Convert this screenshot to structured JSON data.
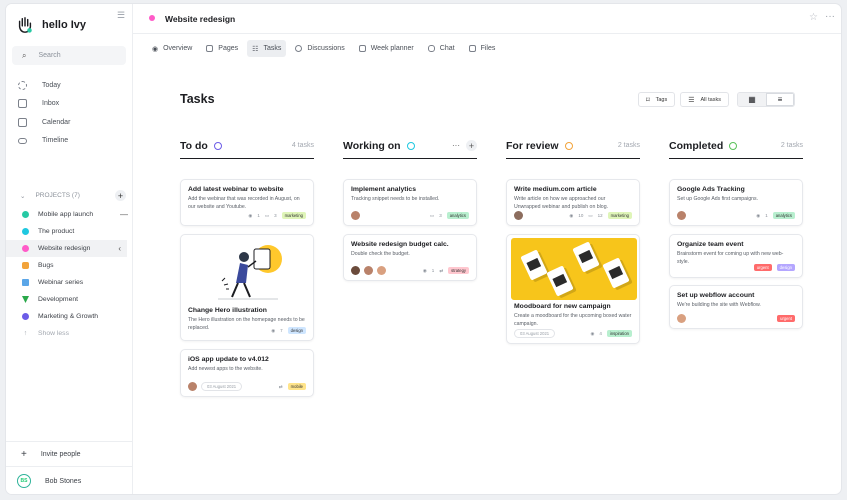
{
  "app": {
    "name": "hello Ivy"
  },
  "sidebar": {
    "search_placeholder": "Search",
    "nav": [
      {
        "label": "Today",
        "icon": "dashed-circle-icon"
      },
      {
        "label": "Inbox",
        "icon": "inbox-icon"
      },
      {
        "label": "Calendar",
        "icon": "calendar-icon"
      },
      {
        "label": "Timeline",
        "icon": "timeline-icon"
      }
    ],
    "projects_label": "PROJECTS (7)",
    "projects": [
      {
        "label": "Mobile app launch",
        "color": "#27c9a4"
      },
      {
        "label": "The product",
        "color": "#1fc8e0"
      },
      {
        "label": "Website redesign",
        "color": "#ff5bc8"
      },
      {
        "label": "Bugs",
        "color": "#f2a33a"
      },
      {
        "label": "Webinar series",
        "color": "#5aa6e8"
      },
      {
        "label": "Development",
        "color": "#2aa84a"
      },
      {
        "label": "Marketing & Growth",
        "color": "#6c5ce7"
      }
    ],
    "show_less": "Show less",
    "invite": "Invite people",
    "user": {
      "initials": "BS",
      "name": "Bob Stones"
    }
  },
  "header": {
    "project": "Website redesign"
  },
  "tabs": [
    {
      "label": "Overview"
    },
    {
      "label": "Pages"
    },
    {
      "label": "Tasks"
    },
    {
      "label": "Discussions"
    },
    {
      "label": "Week planner"
    },
    {
      "label": "Chat"
    },
    {
      "label": "Files"
    }
  ],
  "page": {
    "title": "Tasks",
    "tags_btn": "Tags",
    "all_tasks_btn": "All tasks"
  },
  "columns": [
    {
      "title": "To do",
      "count": "4 tasks",
      "ring": "#6c5ce7"
    },
    {
      "title": "Working on",
      "count": "",
      "ring": "#1fc8e0"
    },
    {
      "title": "For review",
      "count": "2 tasks",
      "ring": "#f2a33a"
    },
    {
      "title": "Completed",
      "count": "2 tasks",
      "ring": "#5ac25a"
    }
  ],
  "cards": {
    "c1": {
      "title": "Add latest webinar to website",
      "desc": "Add the webinar that was recorded in August, on our website and Youtube.",
      "tag": "marketing",
      "tag_color": "#dff5b8",
      "views": "1",
      "comments": "3"
    },
    "c2": {
      "title": "Change Hero illustration",
      "desc": "The Hero illustration on the homepage needs to be replaced.",
      "tag": "design",
      "tag_color": "#cfe6ff",
      "views": "7"
    },
    "c3": {
      "title": "iOS app update to v4.012",
      "desc": "Add newest apps to the website.",
      "date": "03 August 2021",
      "tag": "mobile",
      "tag_color": "#ffe48a"
    },
    "c4": {
      "title": "Implement analytics",
      "desc": "Tracking snippet needs to be installed.",
      "tag": "analytics",
      "tag_color": "#b8efcf",
      "comments": "3"
    },
    "c5": {
      "title": "Website redesign budget calc.",
      "desc": "Double check the budget.",
      "tag": "strategy",
      "tag_color": "#ffc7cf",
      "views": "1"
    },
    "c6": {
      "title": "Write medium.com article",
      "desc": "Write article on how we approached our Unwrapped webinar and publish on blog.",
      "tag": "marketing",
      "tag_color": "#dff5b8",
      "views": "10",
      "comments": "12"
    },
    "c7": {
      "title": "Moodboard for new campaign",
      "desc": "Create a moodboard for the upcoming boxed water campaign.",
      "date": "03 August 2021",
      "tag": "inspiration",
      "tag_color": "#b8efcf",
      "views": "4"
    },
    "c8": {
      "title": "Google Ads Tracking",
      "desc": "Set up Google Ads first campaigns.",
      "tag": "analytics",
      "tag_color": "#b8efcf",
      "views": "1"
    },
    "c9": {
      "title": "Organize team event",
      "desc": "Brainstorm event for coming up with new web-style.",
      "tag1": "urgent",
      "tag1_color": "#ff6b6b",
      "tag2": "design",
      "tag2_color": "#b4a6ff"
    },
    "c10": {
      "title": "Set up webflow account",
      "desc": "We're building the site with Webflow.",
      "tag": "urgent",
      "tag_color": "#ff6b6b"
    }
  },
  "photo_text": "BOXED WATER"
}
